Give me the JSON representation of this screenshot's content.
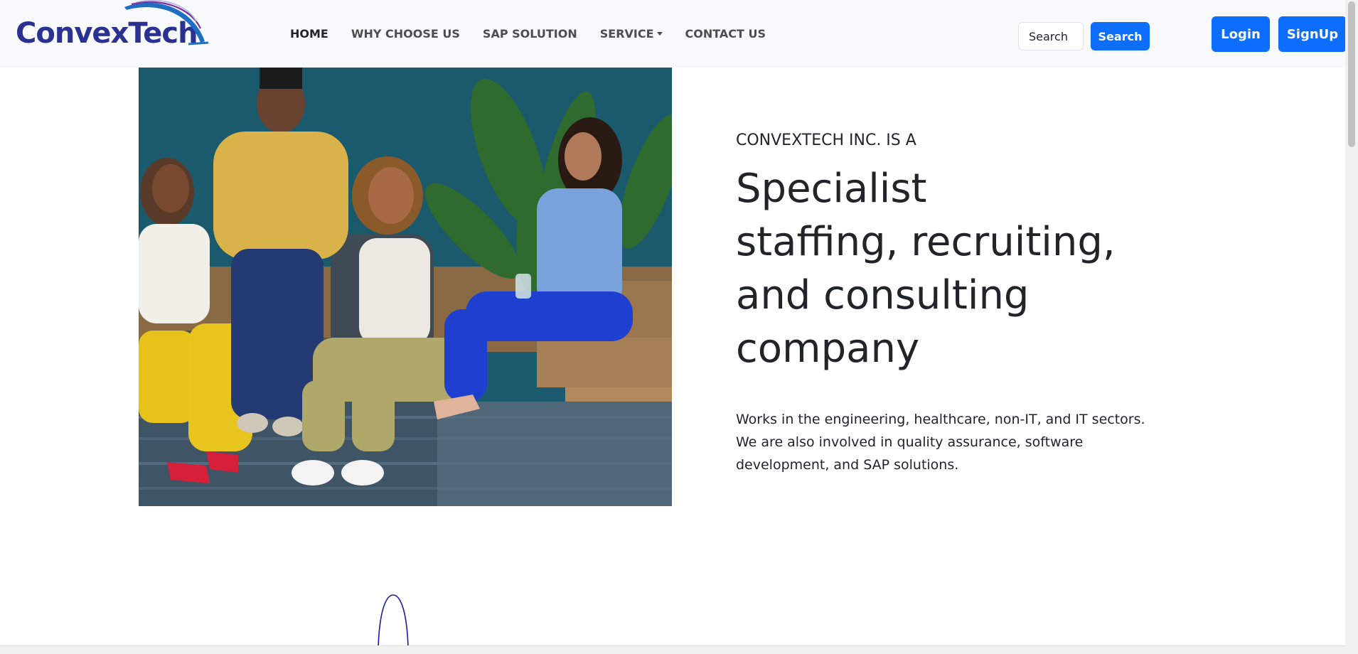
{
  "brand": {
    "name_part1": "Convex",
    "name_part2": "Tech"
  },
  "nav": {
    "items": [
      {
        "label": "HOME",
        "active": true
      },
      {
        "label": "WHY CHOOSE US",
        "active": false
      },
      {
        "label": "SAP SOLUTION",
        "active": false
      },
      {
        "label": "SERVICE",
        "active": false,
        "dropdown": true
      },
      {
        "label": "CONTACT US",
        "active": false
      }
    ]
  },
  "search": {
    "placeholder": "Search",
    "button_label": "Search"
  },
  "auth": {
    "login_label": "Login",
    "signup_label": "SignUp"
  },
  "hero": {
    "eyebrow": "CONVEXTECH INC. IS A",
    "headline_lines": [
      "Specialist",
      "staffing, recruiting,",
      "and consulting",
      "company"
    ],
    "description": "Works in the engineering, healthcare, non-IT, and IT sectors. We are also involved in quality assurance, software development, and SAP solutions."
  },
  "colors": {
    "primary": "#0d6efd",
    "brand_navy": "#2a3192",
    "navbar_bg": "#f8f9fa",
    "text": "#212529"
  }
}
